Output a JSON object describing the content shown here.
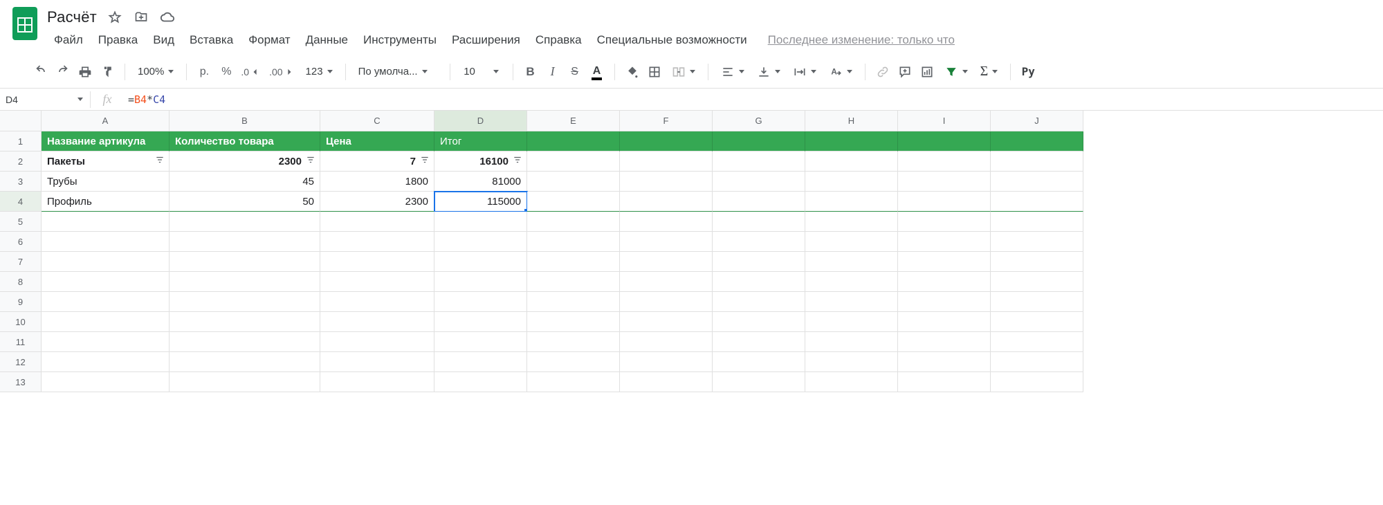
{
  "doc": {
    "title": "Расчёт",
    "last_modified": "Последнее изменение: только что"
  },
  "menu": {
    "file": "Файл",
    "edit": "Правка",
    "view": "Вид",
    "insert": "Вставка",
    "format": "Формат",
    "data": "Данные",
    "tools": "Инструменты",
    "extensions": "Расширения",
    "help": "Справка",
    "accessibility": "Специальные возможности"
  },
  "toolbar": {
    "zoom": "100%",
    "currency": "р.",
    "percent": "%",
    "dec_dec": ".0",
    "inc_dec": ".00",
    "more_formats": "123",
    "font": "По умолча...",
    "font_size": "10",
    "py": "Py"
  },
  "namebox": {
    "ref": "D4"
  },
  "formula": {
    "eq": "=",
    "ref1": "B4",
    "op": "*",
    "ref2": "C4"
  },
  "columns": [
    "A",
    "B",
    "C",
    "D",
    "E",
    "F",
    "G",
    "H",
    "I",
    "J"
  ],
  "rows": [
    "1",
    "2",
    "3",
    "4",
    "5",
    "6",
    "7",
    "8",
    "9",
    "10",
    "11",
    "12",
    "13"
  ],
  "headers": {
    "A": "Название артикула",
    "B": "Количество товара",
    "C": "Цена",
    "D": "Итог"
  },
  "data_rows": [
    {
      "A": "Пакеты",
      "B": "2300",
      "C": "7",
      "D": "16100",
      "bold": true,
      "filter": true
    },
    {
      "A": "Трубы",
      "B": "45",
      "C": "1800",
      "D": "81000",
      "bold": false,
      "filter": false
    },
    {
      "A": "Профиль",
      "B": "50",
      "C": "2300",
      "D": "115000",
      "bold": false,
      "filter": false
    }
  ],
  "selected_cell": "D4",
  "chart_data": {
    "type": "table",
    "columns": [
      "Название артикула",
      "Количество товара",
      "Цена",
      "Итог"
    ],
    "rows": [
      [
        "Пакеты",
        2300,
        7,
        16100
      ],
      [
        "Трубы",
        45,
        1800,
        81000
      ],
      [
        "Профиль",
        50,
        2300,
        115000
      ]
    ]
  }
}
